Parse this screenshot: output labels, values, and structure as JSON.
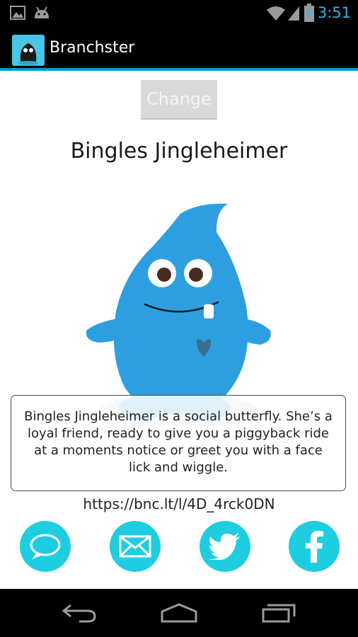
{
  "status_bar": {
    "time": "3:51",
    "icons": [
      "image-icon",
      "android-icon",
      "wifi-icon",
      "signal-icon",
      "battery-icon"
    ]
  },
  "action_bar": {
    "title": "Branchster",
    "icon": "app-icon"
  },
  "main": {
    "change_label": "Change",
    "monster_name": "Bingles Jingleheimer",
    "description": "Bingles Jingleheimer is a social butterfly. She’s a loyal friend, ready to give you a piggyback ride at a moments notice or greet you with a face lick and wiggle.",
    "share_url": "https://bnc.lt/l/4D_4rck0DN"
  },
  "share_buttons": [
    {
      "name": "sms",
      "icon": "chat-bubble-icon"
    },
    {
      "name": "email",
      "icon": "envelope-icon"
    },
    {
      "name": "twitter",
      "icon": "twitter-bird-icon"
    },
    {
      "name": "facebook",
      "icon": "facebook-f-icon"
    }
  ],
  "nav_bar": {
    "buttons": [
      "back-icon",
      "home-icon",
      "recents-icon"
    ]
  },
  "colors": {
    "accent": "#33b5e5",
    "monster": "#2d9fe0",
    "share": "#1fcde0",
    "action_line": "#0099cc"
  }
}
